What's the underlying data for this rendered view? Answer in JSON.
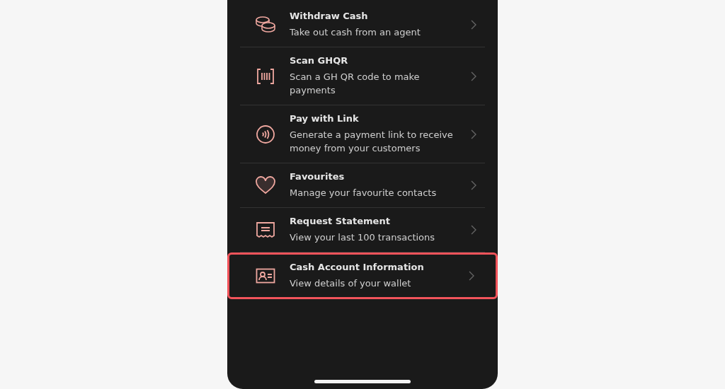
{
  "menu_items": [
    {
      "kind": "coins",
      "title": "Withdraw Cash",
      "description": "Take out cash from an agent",
      "highlighted": false
    },
    {
      "kind": "scan",
      "title": "Scan GHQR",
      "description": "Scan a GH QR code to make payments",
      "highlighted": false
    },
    {
      "kind": "contactless",
      "title": "Pay with Link",
      "description": "Generate a payment link to receive money from your customers",
      "highlighted": false
    },
    {
      "kind": "heart",
      "title": "Favourites",
      "description": "Manage your favourite contacts",
      "highlighted": false
    },
    {
      "kind": "receipt",
      "title": "Request Statement",
      "description": "View your last 100 transactions",
      "highlighted": false
    },
    {
      "kind": "id-card",
      "title": "Cash Account Information",
      "description": "View details of your wallet",
      "highlighted": true
    }
  ]
}
